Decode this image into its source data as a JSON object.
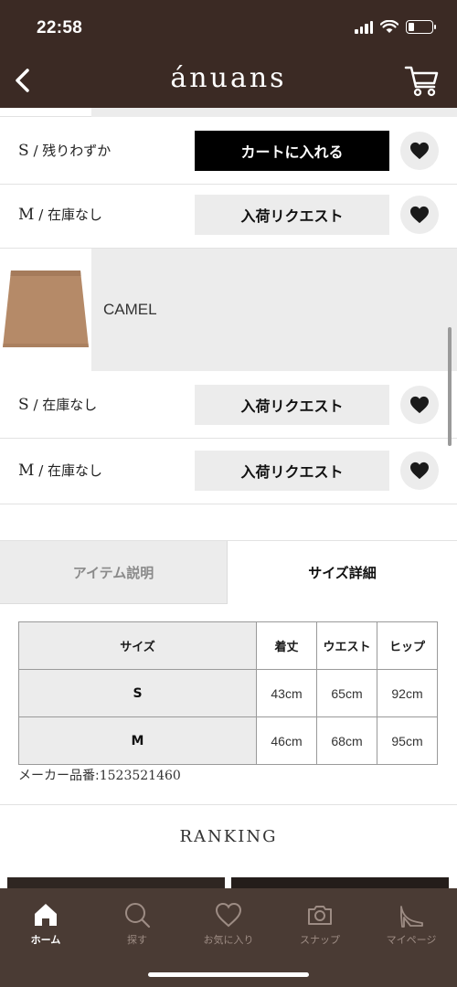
{
  "status": {
    "time": "22:58"
  },
  "header": {
    "logo": "ánuans"
  },
  "sizes_top": [
    {
      "size": "S",
      "stock": "残りわずか",
      "action": "カートに入れる",
      "action_type": "cart"
    },
    {
      "size": "M",
      "stock": "在庫なし",
      "action": "入荷リクエスト",
      "action_type": "request"
    }
  ],
  "color": {
    "name": "CAMEL"
  },
  "sizes_camel": [
    {
      "size": "S",
      "stock": "在庫なし",
      "action": "入荷リクエスト"
    },
    {
      "size": "M",
      "stock": "在庫なし",
      "action": "入荷リクエスト"
    }
  ],
  "separator": "/",
  "tabs": [
    {
      "label": "アイテム説明",
      "active": false
    },
    {
      "label": "サイズ詳細",
      "active": true
    }
  ],
  "size_table": {
    "headers": [
      "サイズ",
      "着丈",
      "ウエスト",
      "ヒップ"
    ],
    "rows": [
      [
        "S",
        "43cm",
        "65cm",
        "92cm"
      ],
      [
        "M",
        "46cm",
        "68cm",
        "95cm"
      ]
    ]
  },
  "maker": {
    "label": "メーカー品番:",
    "number": "1523521460"
  },
  "ranking": {
    "title": "RANKING"
  },
  "bottom_nav": [
    {
      "label": "ホーム",
      "icon": "home-icon",
      "active": true
    },
    {
      "label": "探す",
      "icon": "search-icon",
      "active": false
    },
    {
      "label": "お気に入り",
      "icon": "heart-icon",
      "active": false
    },
    {
      "label": "スナップ",
      "icon": "camera-icon",
      "active": false
    },
    {
      "label": "マイページ",
      "icon": "heel-icon",
      "active": false
    }
  ],
  "colors": {
    "header_bg": "#3b2a24",
    "nav_bg": "#4a3b34",
    "camel": "#b58a68"
  }
}
